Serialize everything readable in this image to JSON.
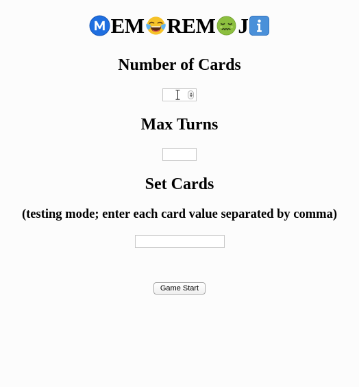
{
  "title": {
    "segments": [
      {
        "kind": "icon",
        "icon": "circled-m-icon"
      },
      {
        "kind": "text",
        "text": "EM"
      },
      {
        "kind": "icon",
        "icon": "tears-of-joy-emoji-icon"
      },
      {
        "kind": "text",
        "text": "REM"
      },
      {
        "kind": "icon",
        "icon": "nauseated-face-emoji-icon"
      },
      {
        "kind": "text",
        "text": "J"
      },
      {
        "kind": "icon",
        "icon": "information-icon"
      }
    ],
    "text_part_1": "EM",
    "text_part_2": "REM",
    "text_part_3": "J"
  },
  "colors": {
    "background": "#fcfcfc",
    "m_circle": "#1f6fe0",
    "info_box": "#4a90d9",
    "emoji_yellow": "#f6c228",
    "nauseated_green": "#8cbf3f"
  },
  "number_of_cards": {
    "heading": "Number of Cards",
    "value": ""
  },
  "max_turns": {
    "heading": "Max Turns",
    "value": ""
  },
  "set_cards": {
    "heading": "Set Cards",
    "note": "(testing mode; enter each card value separated by comma)",
    "value": ""
  },
  "game_start_button": {
    "label": "Game Start"
  }
}
